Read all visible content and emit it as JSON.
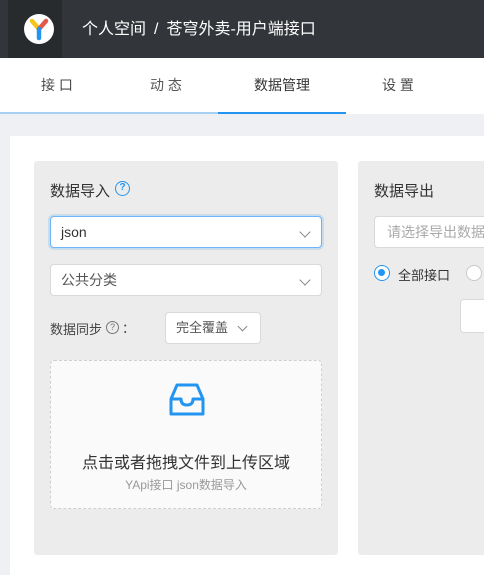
{
  "header": {
    "space": "个人空间",
    "separator": "/",
    "project": "苍穹外卖-用户端接口",
    "logo_colors": [
      "#f7c41c",
      "#e4584c",
      "#2395f1"
    ]
  },
  "tabs": [
    {
      "label": "接 口"
    },
    {
      "label": "动 态"
    },
    {
      "label": "数据管理",
      "active": true
    },
    {
      "label": "设 置"
    }
  ],
  "import": {
    "title": "数据导入",
    "format_value": "json",
    "category_value": "公共分类",
    "sync_label": "数据同步",
    "sync_colon": "：",
    "sync_mode_value": "完全覆盖",
    "dropzone_text": "点击或者拖拽文件到上传区域",
    "dropzone_hint": "YApi接口 json数据导入"
  },
  "export": {
    "title": "数据导出",
    "placeholder": "请选择导出数据的方式",
    "radio_all_label": "全部接口"
  },
  "colors": {
    "accent": "#2395f1",
    "topbar": "#32363a"
  }
}
